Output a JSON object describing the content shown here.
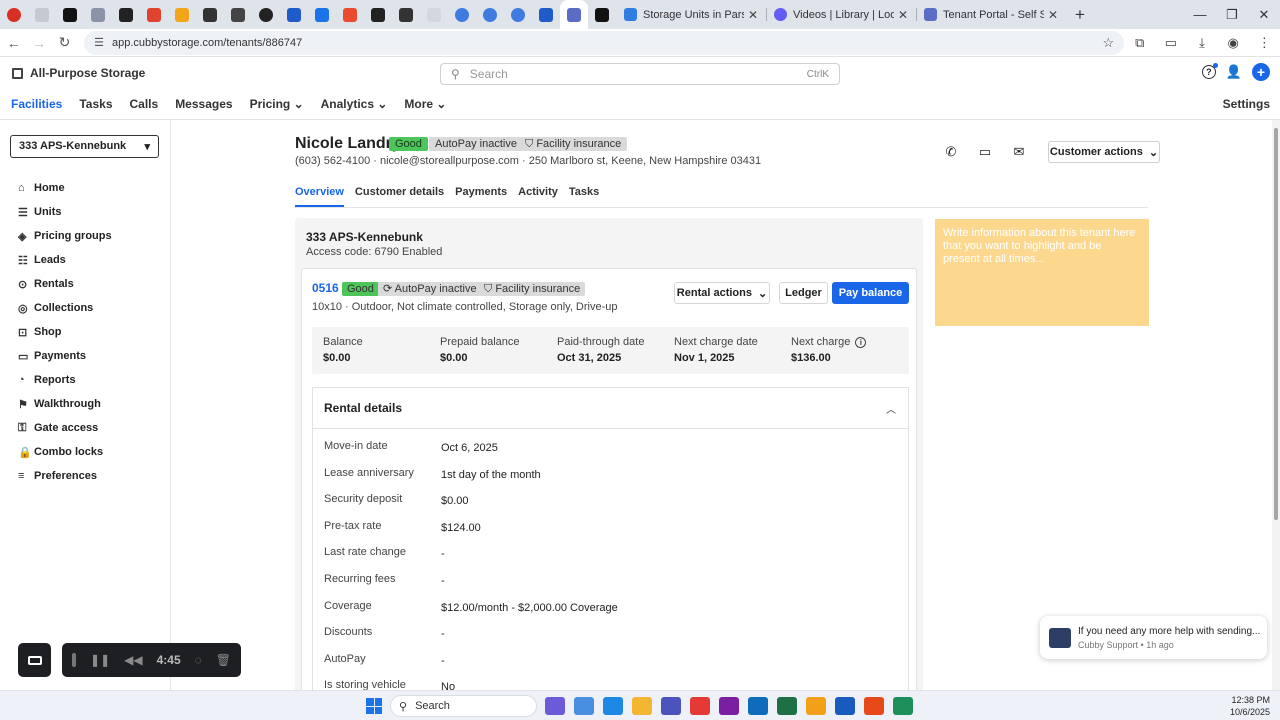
{
  "browser": {
    "pinned_tabs": [
      {
        "icon": "record-icon",
        "color": "#d93025"
      },
      {
        "icon": "tab-icon",
        "color": "#c4c9d2"
      },
      {
        "icon": "s-logo-icon",
        "color": "#111111"
      },
      {
        "icon": "mail-icon",
        "color": "#8a94a6"
      },
      {
        "icon": "check-icon",
        "color": "#222222"
      },
      {
        "icon": "v-logo-icon",
        "color": "#e0442f"
      },
      {
        "icon": "tag-icon",
        "color": "#f2a51a"
      },
      {
        "icon": "openai-icon",
        "color": "#333333"
      },
      {
        "icon": "link-icon",
        "color": "#444444"
      },
      {
        "icon": "check-circle-icon",
        "color": "#222222"
      },
      {
        "icon": "n-logo-icon",
        "color": "#1f5cc9"
      },
      {
        "icon": "s-blue-icon",
        "color": "#1a73e8"
      },
      {
        "icon": "cube-icon",
        "color": "#ea4b2f"
      },
      {
        "icon": "code-icon",
        "color": "#222222"
      },
      {
        "icon": "planet-icon",
        "color": "#333333"
      },
      {
        "icon": "blank-icon",
        "color": "#d3d7de"
      },
      {
        "icon": "globe-icon",
        "color": "#3f7be0"
      },
      {
        "icon": "globe-icon",
        "color": "#3f7be0"
      },
      {
        "icon": "globe-icon",
        "color": "#3f7be0"
      },
      {
        "icon": "link-icon",
        "color": "#1f5cc9"
      },
      {
        "icon": "grid-icon",
        "color": "#5b6cc7"
      },
      {
        "icon": "s-logo-icon",
        "color": "#111111"
      }
    ],
    "tabs": [
      {
        "title": "Storage Units in Parsonsfield",
        "icon_color": "#2f7de1"
      },
      {
        "title": "Videos | Library | Loom",
        "icon_color": "#625df5"
      },
      {
        "title": "Tenant Portal - Self Storage",
        "icon_color": "#5b6cc7"
      }
    ],
    "url": "app.cubbystorage.com/tenants/886747"
  },
  "app": {
    "brand": "All-Purpose Storage",
    "search_placeholder": "Search",
    "search_shortcut": "CtrlK",
    "nav": [
      {
        "label": "Facilities",
        "active": true,
        "dropdown": false
      },
      {
        "label": "Tasks",
        "active": false,
        "dropdown": false
      },
      {
        "label": "Calls",
        "active": false,
        "dropdown": false
      },
      {
        "label": "Messages",
        "active": false,
        "dropdown": false
      },
      {
        "label": "Pricing",
        "active": false,
        "dropdown": true
      },
      {
        "label": "Analytics",
        "active": false,
        "dropdown": true
      },
      {
        "label": "More",
        "active": false,
        "dropdown": true
      }
    ],
    "settings": "Settings"
  },
  "sidebar": {
    "facility": "333 APS-Kennebunk",
    "items": [
      {
        "label": "Home",
        "icon": "home-icon"
      },
      {
        "label": "Units",
        "icon": "units-icon"
      },
      {
        "label": "Pricing groups",
        "icon": "pricing-icon"
      },
      {
        "label": "Leads",
        "icon": "leads-icon"
      },
      {
        "label": "Rentals",
        "icon": "rentals-icon"
      },
      {
        "label": "Collections",
        "icon": "collections-icon"
      },
      {
        "label": "Shop",
        "icon": "shop-icon"
      },
      {
        "label": "Payments",
        "icon": "payments-icon"
      },
      {
        "label": "Reports",
        "icon": "reports-icon"
      },
      {
        "label": "Walkthrough",
        "icon": "walkthrough-icon"
      },
      {
        "label": "Gate access",
        "icon": "gate-icon"
      },
      {
        "label": "Combo locks",
        "icon": "lock-icon"
      },
      {
        "label": "Preferences",
        "icon": "preferences-icon"
      }
    ]
  },
  "recorder": {
    "time": "4:45"
  },
  "tenant": {
    "name": "Nicole Landry",
    "badges": {
      "status": "Good",
      "autopay": "AutoPay inactive",
      "insurance": "Facility insurance"
    },
    "contact": "(603) 562-4100 · nicole@storeallpurpose.com · 250 Marlboro st, Keene, New Hampshire 03431",
    "customer_actions": "Customer actions",
    "tabs": [
      "Overview",
      "Customer details",
      "Payments",
      "Activity",
      "Tasks"
    ]
  },
  "facility_card": {
    "name": "333 APS-Kennebunk",
    "access": "Access code: 6790 Enabled",
    "unit": {
      "number": "0516",
      "status": "Good",
      "autopay": "AutoPay inactive",
      "insurance": "Facility insurance",
      "description": "10x10 · Outdoor, Not climate controlled, Storage only, Drive-up",
      "rental_actions": "Rental actions",
      "ledger": "Ledger",
      "pay_balance": "Pay balance",
      "stats": [
        {
          "label": "Balance",
          "value": "$0.00"
        },
        {
          "label": "Prepaid balance",
          "value": "$0.00"
        },
        {
          "label": "Paid-through date",
          "value": "Oct 31, 2025"
        },
        {
          "label": "Next charge date",
          "value": "Nov 1, 2025"
        },
        {
          "label": "Next charge",
          "value": "$136.00"
        }
      ],
      "rental_details": {
        "title": "Rental details",
        "rows": [
          {
            "key": "Move-in date",
            "value": "Oct 6, 2025"
          },
          {
            "key": "Lease anniversary",
            "value": "1st day of the month"
          },
          {
            "key": "Security deposit",
            "value": "$0.00"
          },
          {
            "key": "Pre-tax rate",
            "value": "$124.00"
          },
          {
            "key": "Last rate change",
            "value": "-"
          },
          {
            "key": "Recurring fees",
            "value": "-"
          },
          {
            "key": "Coverage",
            "value": "$12.00/month - $2,000.00 Coverage"
          },
          {
            "key": "Discounts",
            "value": "-"
          },
          {
            "key": "AutoPay",
            "value": "-"
          },
          {
            "key": "Is storing vehicle",
            "value": "No"
          }
        ]
      }
    }
  },
  "notes": {
    "placeholder": "Write information about this tenant here that you want to highlight and be present at all times..."
  },
  "toast": {
    "message": "If you need any more help with sending...",
    "meta": "Cubby Support • 1h ago"
  },
  "taskbar": {
    "search": "Search",
    "apps": [
      "#6b5bd6",
      "#4a8ee0",
      "#1e88e5",
      "#f2b632",
      "#4b53bc",
      "#e53935",
      "#7b1fa2",
      "#0f6cbd",
      "#1d7044",
      "#f29f1a",
      "#185abd",
      "#e64a19",
      "#1e8e5a"
    ],
    "time": "12:38 PM",
    "date": "10/6/2025"
  },
  "colors": {
    "accent": "#1a66e8",
    "good": "#4dc55b",
    "notes": "#fcd88e"
  }
}
